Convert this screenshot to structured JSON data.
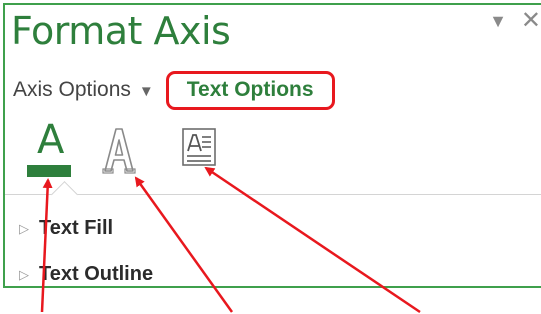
{
  "panel": {
    "title": "Format Axis",
    "controls": {
      "dropdown_icon": "triangle-down-icon",
      "close_icon": "close-icon"
    }
  },
  "tabs": {
    "axis_options": "Axis Options",
    "text_options": "Text Options"
  },
  "icon_tabs": [
    {
      "icon": "text-fill-icon",
      "glyph": "A",
      "selected": true
    },
    {
      "icon": "text-outline-icon",
      "glyph": "A",
      "selected": false
    },
    {
      "icon": "textbox-icon",
      "glyph": "A",
      "selected": false
    }
  ],
  "sections": [
    {
      "label": "Text Fill"
    },
    {
      "label": "Text Outline"
    }
  ],
  "colors": {
    "accent_green": "#2e7f3c",
    "highlight_red": "#e8181e",
    "border_green": "#3fa04c"
  }
}
